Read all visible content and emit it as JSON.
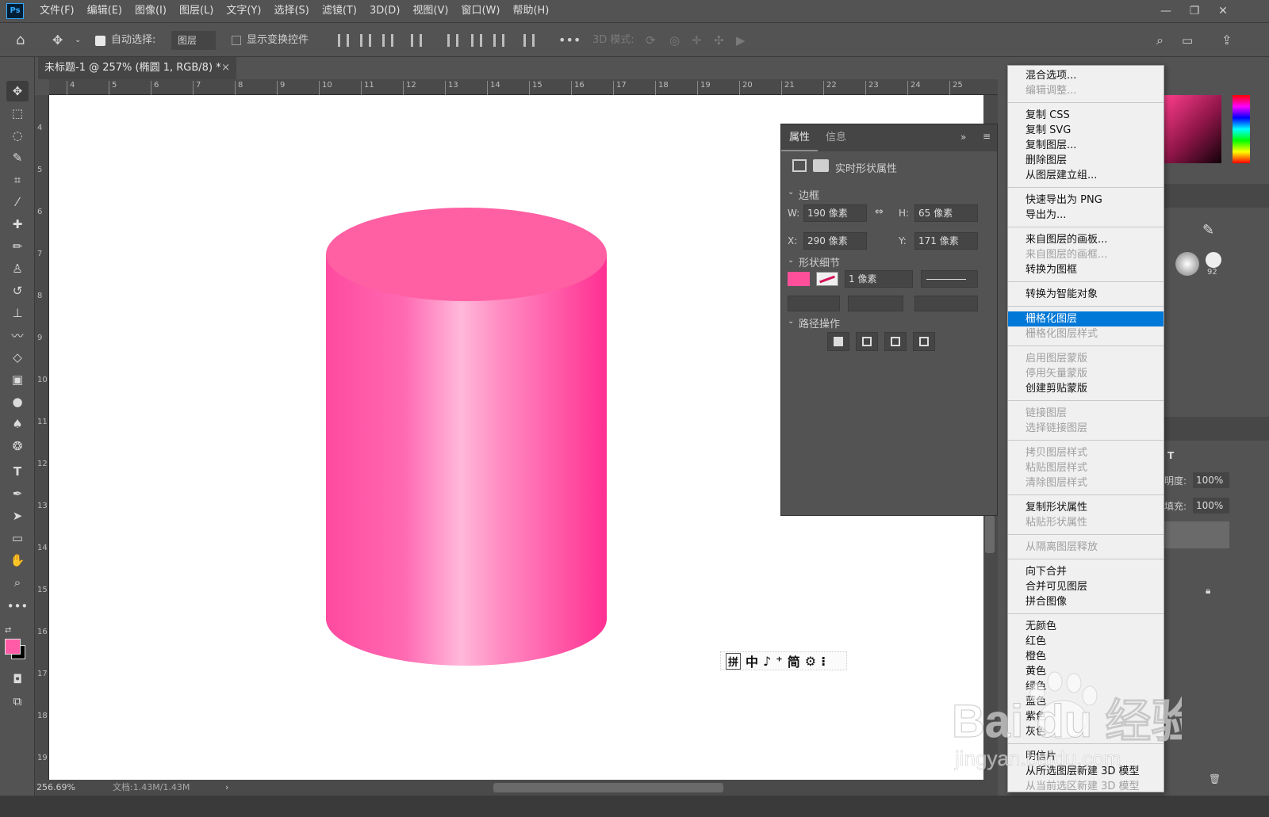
{
  "menubar": {
    "logo": "Ps",
    "items": [
      "文件(F)",
      "编辑(E)",
      "图像(I)",
      "图层(L)",
      "文字(Y)",
      "选择(S)",
      "滤镜(T)",
      "3D(D)",
      "视图(V)",
      "窗口(W)",
      "帮助(H)"
    ]
  },
  "options": {
    "auto_select_label": "自动选择:",
    "auto_select_target": "图层",
    "show_transform_label": "显示变换控件",
    "threed_mode_label": "3D 模式:"
  },
  "document": {
    "tab_title": "未标题-1 @ 257% (椭圆 1, RGB/8) *",
    "ruler_h": [
      "4",
      "5",
      "6",
      "7",
      "8",
      "9",
      "10",
      "11",
      "12",
      "13",
      "14",
      "15",
      "16",
      "17",
      "18",
      "19",
      "20",
      "21",
      "22",
      "23",
      "24",
      "25"
    ],
    "ruler_v": [
      "4",
      "5",
      "6",
      "7",
      "8",
      "9",
      "10",
      "11",
      "12",
      "13",
      "14",
      "15",
      "16",
      "17",
      "18",
      "19"
    ],
    "zoom": "256.69%",
    "doc_info": "文档:1.43M/1.43M",
    "shape_color": "#ff4fa0"
  },
  "ime": {
    "items": [
      "拼",
      "中",
      "♪",
      "⁺",
      "简",
      "⚙",
      "⁝"
    ]
  },
  "properties": {
    "tab_active": "属性",
    "tab_other": "信息",
    "section_title": "实时形状属性",
    "bounds_title": "边框",
    "w_label": "W:",
    "w_value": "190 像素",
    "h_label": "H:",
    "h_value": "65 像素",
    "x_label": "X:",
    "x_value": "290 像素",
    "y_label": "Y:",
    "y_value": "171 像素",
    "shape_details_title": "形状细节",
    "stroke_width": "1 像素",
    "fill_color": "#ff4f9a",
    "path_ops_title": "路径操作"
  },
  "right_panel": {
    "opacity_label": "明度:",
    "opacity_value": "100%",
    "fill_label": "填充:",
    "fill_value": "100%",
    "brush_size": "92"
  },
  "context_menu": {
    "items": [
      {
        "label": "混合选项...",
        "disabled": false
      },
      {
        "label": "编辑调整...",
        "disabled": true
      },
      {
        "label": "复制 CSS",
        "disabled": false
      },
      {
        "label": "复制 SVG",
        "disabled": false
      },
      {
        "label": "复制图层...",
        "disabled": false
      },
      {
        "label": "删除图层",
        "disabled": false
      },
      {
        "label": "从图层建立组...",
        "disabled": false
      },
      {
        "label": "快速导出为 PNG",
        "disabled": false
      },
      {
        "label": "导出为...",
        "disabled": false
      },
      {
        "label": "来自图层的画板...",
        "disabled": false
      },
      {
        "label": "来自图层的画框...",
        "disabled": true
      },
      {
        "label": "转换为图框",
        "disabled": false
      },
      {
        "label": "转换为智能对象",
        "disabled": false
      },
      {
        "label": "栅格化图层",
        "disabled": false,
        "highlighted": true
      },
      {
        "label": "栅格化图层样式",
        "disabled": true
      },
      {
        "label": "启用图层蒙版",
        "disabled": true
      },
      {
        "label": "停用矢量蒙版",
        "disabled": true
      },
      {
        "label": "创建剪贴蒙版",
        "disabled": false
      },
      {
        "label": "链接图层",
        "disabled": true
      },
      {
        "label": "选择链接图层",
        "disabled": true
      },
      {
        "label": "拷贝图层样式",
        "disabled": true
      },
      {
        "label": "粘贴图层样式",
        "disabled": true
      },
      {
        "label": "清除图层样式",
        "disabled": true
      },
      {
        "label": "复制形状属性",
        "disabled": false
      },
      {
        "label": "粘贴形状属性",
        "disabled": true
      },
      {
        "label": "从隔离图层释放",
        "disabled": true
      },
      {
        "label": "向下合并",
        "disabled": false
      },
      {
        "label": "合并可见图层",
        "disabled": false
      },
      {
        "label": "拼合图像",
        "disabled": false
      },
      {
        "label": "无颜色",
        "disabled": false
      },
      {
        "label": "红色",
        "disabled": false
      },
      {
        "label": "橙色",
        "disabled": false
      },
      {
        "label": "黄色",
        "disabled": false
      },
      {
        "label": "绿色",
        "disabled": false
      },
      {
        "label": "蓝色",
        "disabled": false
      },
      {
        "label": "紫色",
        "disabled": false
      },
      {
        "label": "灰色",
        "disabled": false
      },
      {
        "label": "明信片",
        "disabled": false
      },
      {
        "label": "从所选图层新建 3D 模型",
        "disabled": false
      },
      {
        "label": "从当前选区新建 3D 模型",
        "disabled": true
      }
    ]
  },
  "watermark": {
    "brand": "Bai du 经验",
    "url": "jingyan.baidu.com"
  }
}
